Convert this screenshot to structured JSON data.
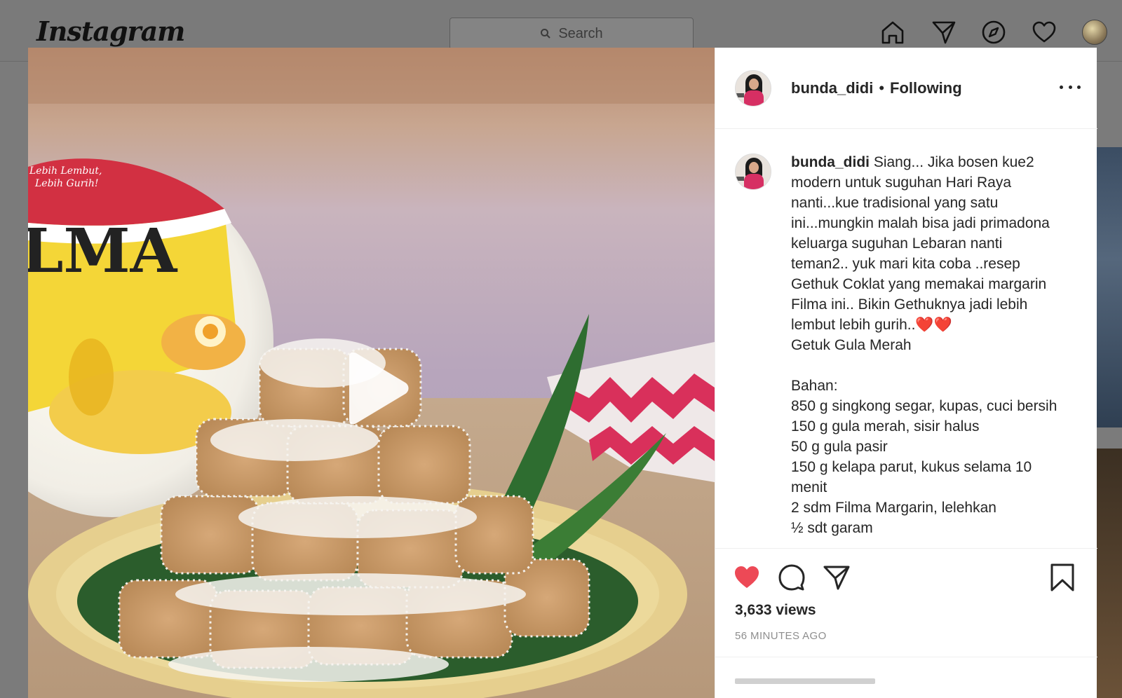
{
  "app": {
    "logo": "Instagram",
    "search_placeholder": "Search"
  },
  "post": {
    "username": "bunda_didi",
    "separator": "•",
    "follow_status": "Following",
    "caption_username": "bunda_didi",
    "caption_text": " Siang... Jika bosen kue2 modern untuk suguhan Hari Raya nanti...kue tradisional yang satu ini...mungkin malah bisa jadi primadona keluarga suguhan Lebaran nanti teman2.. yuk mari kita coba ..resep Gethuk Coklat yang memakai margarin Filma ini.. Bikin Gethuknya jadi lebih lembut lebih gurih..❤️❤️\nGetuk Gula Merah\n\nBahan:\n850 g singkong segar, kupas, cuci bersih\n150 g gula merah, sisir halus\n50 g gula pasir\n150 g kelapa parut, kukus selama 10 menit\n2 sdm Filma Margarin, lelehkan\n½ sdt garam",
    "views": "3,633 views",
    "time_ago": "56 MINUTES AGO",
    "liked": true,
    "like_color": "#ed4956"
  },
  "media": {
    "brand_label": "LMA",
    "tagline_line1": "Lebih Lembut,",
    "tagline_line2": "Lebih Gurih!"
  }
}
